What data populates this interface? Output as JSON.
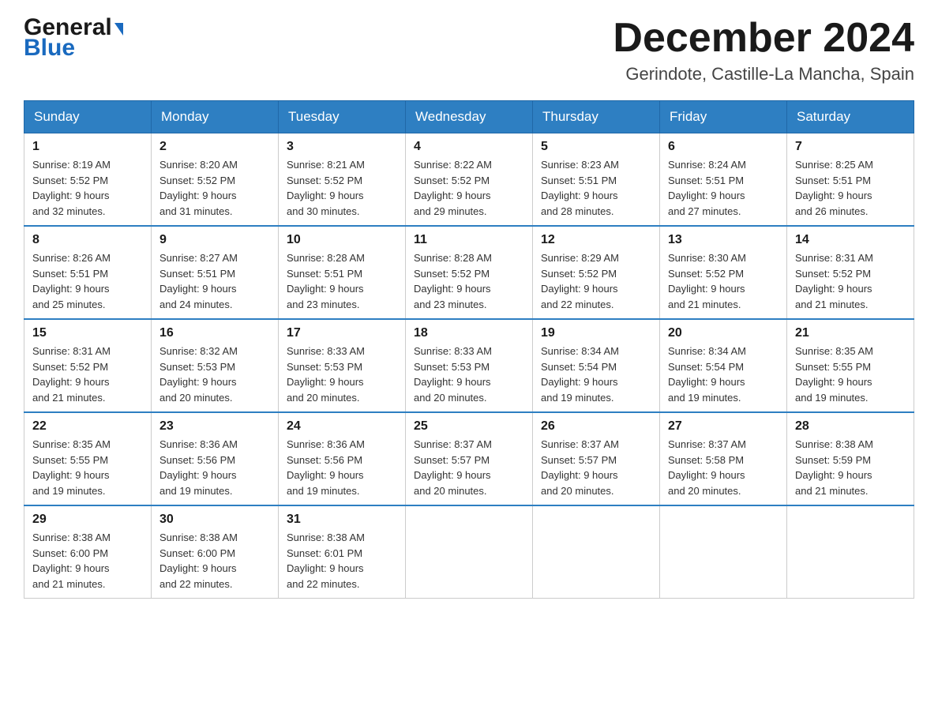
{
  "header": {
    "logo": {
      "line1": "General",
      "line2": "Blue"
    },
    "title": "December 2024",
    "location": "Gerindote, Castille-La Mancha, Spain"
  },
  "calendar": {
    "days_of_week": [
      "Sunday",
      "Monday",
      "Tuesday",
      "Wednesday",
      "Thursday",
      "Friday",
      "Saturday"
    ],
    "weeks": [
      [
        {
          "day": "1",
          "sunrise": "8:19 AM",
          "sunset": "5:52 PM",
          "daylight": "9 hours and 32 minutes."
        },
        {
          "day": "2",
          "sunrise": "8:20 AM",
          "sunset": "5:52 PM",
          "daylight": "9 hours and 31 minutes."
        },
        {
          "day": "3",
          "sunrise": "8:21 AM",
          "sunset": "5:52 PM",
          "daylight": "9 hours and 30 minutes."
        },
        {
          "day": "4",
          "sunrise": "8:22 AM",
          "sunset": "5:52 PM",
          "daylight": "9 hours and 29 minutes."
        },
        {
          "day": "5",
          "sunrise": "8:23 AM",
          "sunset": "5:51 PM",
          "daylight": "9 hours and 28 minutes."
        },
        {
          "day": "6",
          "sunrise": "8:24 AM",
          "sunset": "5:51 PM",
          "daylight": "9 hours and 27 minutes."
        },
        {
          "day": "7",
          "sunrise": "8:25 AM",
          "sunset": "5:51 PM",
          "daylight": "9 hours and 26 minutes."
        }
      ],
      [
        {
          "day": "8",
          "sunrise": "8:26 AM",
          "sunset": "5:51 PM",
          "daylight": "9 hours and 25 minutes."
        },
        {
          "day": "9",
          "sunrise": "8:27 AM",
          "sunset": "5:51 PM",
          "daylight": "9 hours and 24 minutes."
        },
        {
          "day": "10",
          "sunrise": "8:28 AM",
          "sunset": "5:51 PM",
          "daylight": "9 hours and 23 minutes."
        },
        {
          "day": "11",
          "sunrise": "8:28 AM",
          "sunset": "5:52 PM",
          "daylight": "9 hours and 23 minutes."
        },
        {
          "day": "12",
          "sunrise": "8:29 AM",
          "sunset": "5:52 PM",
          "daylight": "9 hours and 22 minutes."
        },
        {
          "day": "13",
          "sunrise": "8:30 AM",
          "sunset": "5:52 PM",
          "daylight": "9 hours and 21 minutes."
        },
        {
          "day": "14",
          "sunrise": "8:31 AM",
          "sunset": "5:52 PM",
          "daylight": "9 hours and 21 minutes."
        }
      ],
      [
        {
          "day": "15",
          "sunrise": "8:31 AM",
          "sunset": "5:52 PM",
          "daylight": "9 hours and 21 minutes."
        },
        {
          "day": "16",
          "sunrise": "8:32 AM",
          "sunset": "5:53 PM",
          "daylight": "9 hours and 20 minutes."
        },
        {
          "day": "17",
          "sunrise": "8:33 AM",
          "sunset": "5:53 PM",
          "daylight": "9 hours and 20 minutes."
        },
        {
          "day": "18",
          "sunrise": "8:33 AM",
          "sunset": "5:53 PM",
          "daylight": "9 hours and 20 minutes."
        },
        {
          "day": "19",
          "sunrise": "8:34 AM",
          "sunset": "5:54 PM",
          "daylight": "9 hours and 19 minutes."
        },
        {
          "day": "20",
          "sunrise": "8:34 AM",
          "sunset": "5:54 PM",
          "daylight": "9 hours and 19 minutes."
        },
        {
          "day": "21",
          "sunrise": "8:35 AM",
          "sunset": "5:55 PM",
          "daylight": "9 hours and 19 minutes."
        }
      ],
      [
        {
          "day": "22",
          "sunrise": "8:35 AM",
          "sunset": "5:55 PM",
          "daylight": "9 hours and 19 minutes."
        },
        {
          "day": "23",
          "sunrise": "8:36 AM",
          "sunset": "5:56 PM",
          "daylight": "9 hours and 19 minutes."
        },
        {
          "day": "24",
          "sunrise": "8:36 AM",
          "sunset": "5:56 PM",
          "daylight": "9 hours and 19 minutes."
        },
        {
          "day": "25",
          "sunrise": "8:37 AM",
          "sunset": "5:57 PM",
          "daylight": "9 hours and 20 minutes."
        },
        {
          "day": "26",
          "sunrise": "8:37 AM",
          "sunset": "5:57 PM",
          "daylight": "9 hours and 20 minutes."
        },
        {
          "day": "27",
          "sunrise": "8:37 AM",
          "sunset": "5:58 PM",
          "daylight": "9 hours and 20 minutes."
        },
        {
          "day": "28",
          "sunrise": "8:38 AM",
          "sunset": "5:59 PM",
          "daylight": "9 hours and 21 minutes."
        }
      ],
      [
        {
          "day": "29",
          "sunrise": "8:38 AM",
          "sunset": "6:00 PM",
          "daylight": "9 hours and 21 minutes."
        },
        {
          "day": "30",
          "sunrise": "8:38 AM",
          "sunset": "6:00 PM",
          "daylight": "9 hours and 22 minutes."
        },
        {
          "day": "31",
          "sunrise": "8:38 AM",
          "sunset": "6:01 PM",
          "daylight": "9 hours and 22 minutes."
        },
        null,
        null,
        null,
        null
      ]
    ],
    "labels": {
      "sunrise": "Sunrise:",
      "sunset": "Sunset:",
      "daylight": "Daylight:"
    }
  }
}
